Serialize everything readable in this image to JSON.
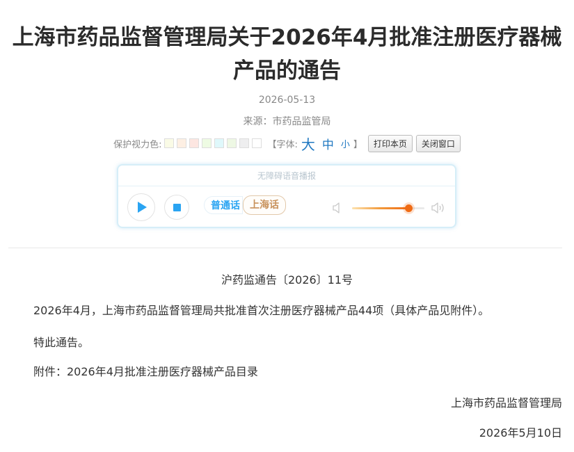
{
  "article": {
    "title": "上海市药品监督管理局关于2026年4月批准注册医疗器械产品的通告",
    "date": "2026-05-13",
    "source": "来源：市药品监管局"
  },
  "toolbar": {
    "eye_color_label": "保护视力色:",
    "swatch_colors": [
      "#fafbe6",
      "#fdefe3",
      "#fde6e1",
      "#eefbe3",
      "#dff8fb",
      "#eef8e4",
      "#eeeeef",
      "#ffffff"
    ],
    "font_label": "【字体:",
    "font_big": "大",
    "font_mid": "中",
    "font_small": "小",
    "font_close": "】",
    "print_label": "打印本页",
    "close_label": "关闭窗口"
  },
  "player": {
    "header": "无障碍语音播报",
    "lang_mandarin": "普通话",
    "lang_shanghai": "上海话",
    "volume_level": 0.78
  },
  "content": {
    "doc_number": "沪药监通告〔2026〕11号",
    "paragraph1": "2026年4月，上海市药品监督管理局共批准首次注册医疗器械产品44项（具体产品见附件）。",
    "paragraph2": "特此通告。",
    "attachment": "附件：2026年4月批准注册医疗器械产品目录",
    "signature_org": "上海市药品监督管理局",
    "signature_date": "2026年5月10日"
  },
  "colors": {
    "link_blue": "#1f78c1",
    "player_blue": "#2aa4f2",
    "accent_orange": "#ef6b14"
  }
}
